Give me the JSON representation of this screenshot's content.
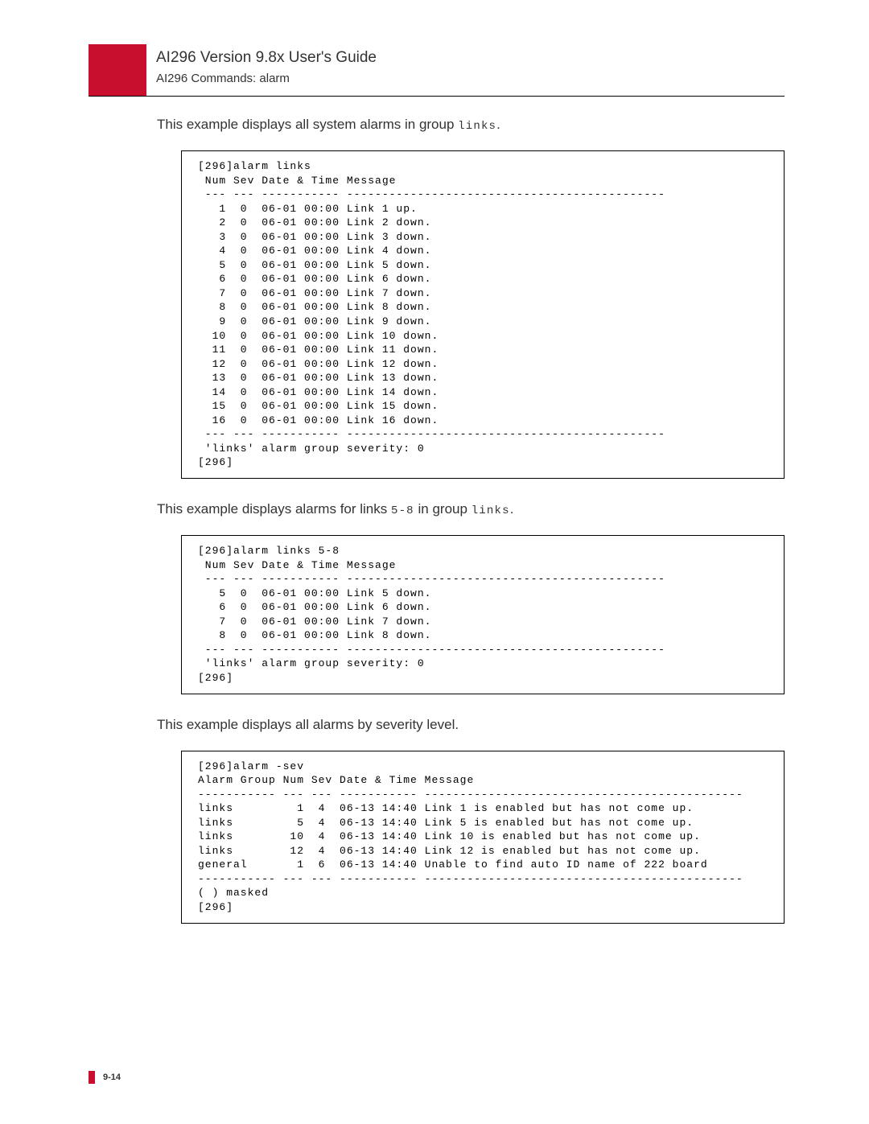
{
  "header": {
    "title": "AI296 Version 9.8x User's Guide",
    "subtitle": "AI296 Commands: alarm"
  },
  "para1": {
    "pre": "This example displays all system alarms in group ",
    "code": "links",
    "post": "."
  },
  "block1": "[296]alarm links\n Num Sev Date & Time Message\n --- --- ----------- ---------------------------------------------\n   1  0  06-01 00:00 Link 1 up.\n   2  0  06-01 00:00 Link 2 down.\n   3  0  06-01 00:00 Link 3 down.\n   4  0  06-01 00:00 Link 4 down.\n   5  0  06-01 00:00 Link 5 down.\n   6  0  06-01 00:00 Link 6 down.\n   7  0  06-01 00:00 Link 7 down.\n   8  0  06-01 00:00 Link 8 down.\n   9  0  06-01 00:00 Link 9 down.\n  10  0  06-01 00:00 Link 10 down.\n  11  0  06-01 00:00 Link 11 down.\n  12  0  06-01 00:00 Link 12 down.\n  13  0  06-01 00:00 Link 13 down.\n  14  0  06-01 00:00 Link 14 down.\n  15  0  06-01 00:00 Link 15 down.\n  16  0  06-01 00:00 Link 16 down.\n --- --- ----------- ---------------------------------------------\n 'links' alarm group severity: 0\n[296]",
  "para2": {
    "pre": "This example displays alarms for links ",
    "code1": "5-8",
    "mid": " in group ",
    "code2": "links",
    "post": "."
  },
  "block2": "[296]alarm links 5-8\n Num Sev Date & Time Message\n --- --- ----------- ---------------------------------------------\n   5  0  06-01 00:00 Link 5 down.\n   6  0  06-01 00:00 Link 6 down.\n   7  0  06-01 00:00 Link 7 down.\n   8  0  06-01 00:00 Link 8 down.\n --- --- ----------- ---------------------------------------------\n 'links' alarm group severity: 0\n[296]",
  "para3": "This example displays all alarms by severity level.",
  "block3": "[296]alarm -sev\nAlarm Group Num Sev Date & Time Message\n----------- --- --- ----------- ---------------------------------------------\nlinks         1  4  06-13 14:40 Link 1 is enabled but has not come up.\nlinks         5  4  06-13 14:40 Link 5 is enabled but has not come up.\nlinks        10  4  06-13 14:40 Link 10 is enabled but has not come up.\nlinks        12  4  06-13 14:40 Link 12 is enabled but has not come up.\ngeneral       1  6  06-13 14:40 Unable to find auto ID name of 222 board\n----------- --- --- ----------- ---------------------------------------------\n( ) masked\n[296]",
  "footer": {
    "pagenum": "9-14"
  }
}
